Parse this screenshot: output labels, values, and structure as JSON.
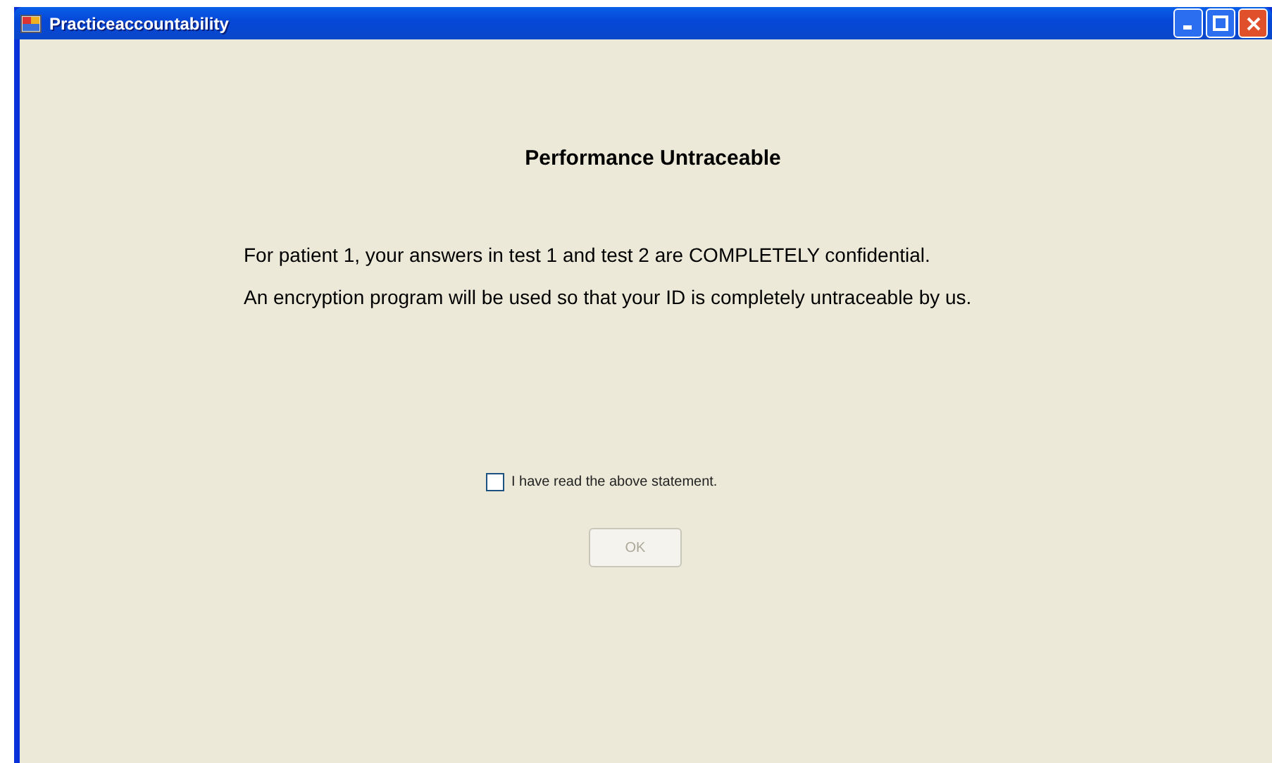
{
  "window": {
    "title": "Practiceaccountability"
  },
  "heading": "Performance Untraceable",
  "paragraphs": [
    "For patient 1, your answers in test 1 and test 2 are COMPLETELY confidential.",
    "An encryption program will be used so that your ID is completely untraceable by us."
  ],
  "checkbox": {
    "label": "I have read the above statement.",
    "checked": false
  },
  "ok_button": {
    "label": "OK",
    "disabled": true
  }
}
